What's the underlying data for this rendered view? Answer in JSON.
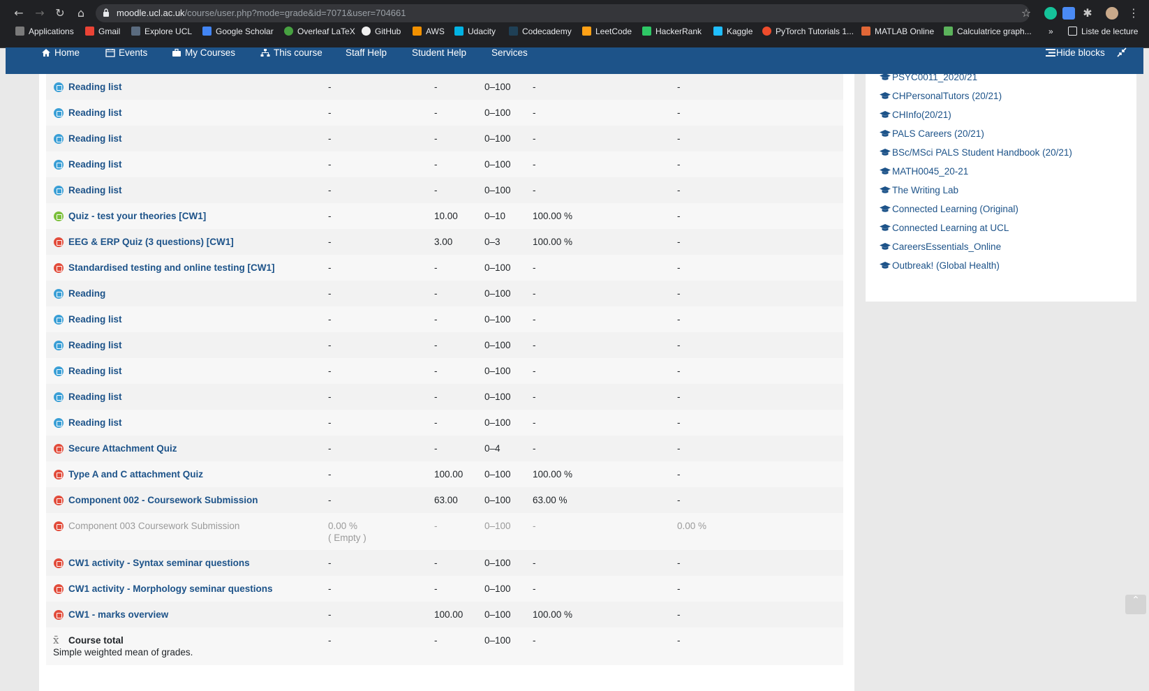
{
  "browser": {
    "url_host": "moodle.ucl.ac.uk",
    "url_path": "/course/user.php?mode=grade&id=7071&user=704661",
    "bookmarks": [
      "Applications",
      "Gmail",
      "Explore UCL",
      "Google Scholar",
      "Overleaf LaTeX",
      "GitHub",
      "AWS",
      "Udacity",
      "Codecademy",
      "LeetCode",
      "HackerRank",
      "Kaggle",
      "PyTorch Tutorials 1...",
      "MATLAB Online",
      "Calculatrice graph...",
      "»",
      "Liste de lecture"
    ]
  },
  "navbar": {
    "home": "Home",
    "events": "Events",
    "my_courses": "My Courses",
    "this_course": "This course",
    "staff_help": "Staff Help",
    "student_help": "Student Help",
    "services": "Services",
    "hide_blocks": "Hide blocks"
  },
  "grades": [
    {
      "name": "Reading list",
      "icon": "blue",
      "weight": "-",
      "grade": "-",
      "range": "0–100",
      "percentage": "-",
      "contribution": "-"
    },
    {
      "name": "Reading list",
      "icon": "blue",
      "weight": "-",
      "grade": "-",
      "range": "0–100",
      "percentage": "-",
      "contribution": "-"
    },
    {
      "name": "Reading list",
      "icon": "blue",
      "weight": "-",
      "grade": "-",
      "range": "0–100",
      "percentage": "-",
      "contribution": "-"
    },
    {
      "name": "Reading list",
      "icon": "blue",
      "weight": "-",
      "grade": "-",
      "range": "0–100",
      "percentage": "-",
      "contribution": "-"
    },
    {
      "name": "Reading list",
      "icon": "blue",
      "weight": "-",
      "grade": "-",
      "range": "0–100",
      "percentage": "-",
      "contribution": "-"
    },
    {
      "name": "Quiz - test your theories [CW1]",
      "icon": "green",
      "weight": "-",
      "grade": "10.00",
      "range": "0–10",
      "percentage": "100.00 %",
      "contribution": "-"
    },
    {
      "name": "EEG & ERP Quiz (3 questions) [CW1]",
      "icon": "red",
      "weight": "-",
      "grade": "3.00",
      "range": "0–3",
      "percentage": "100.00 %",
      "contribution": "-"
    },
    {
      "name": "Standardised testing and online testing [CW1]",
      "icon": "red",
      "weight": "-",
      "grade": "-",
      "range": "0–100",
      "percentage": "-",
      "contribution": "-"
    },
    {
      "name": "Reading",
      "icon": "blue",
      "weight": "-",
      "grade": "-",
      "range": "0–100",
      "percentage": "-",
      "contribution": "-"
    },
    {
      "name": "Reading list",
      "icon": "blue",
      "weight": "-",
      "grade": "-",
      "range": "0–100",
      "percentage": "-",
      "contribution": "-"
    },
    {
      "name": "Reading list",
      "icon": "blue",
      "weight": "-",
      "grade": "-",
      "range": "0–100",
      "percentage": "-",
      "contribution": "-"
    },
    {
      "name": "Reading list",
      "icon": "blue",
      "weight": "-",
      "grade": "-",
      "range": "0–100",
      "percentage": "-",
      "contribution": "-"
    },
    {
      "name": "Reading list",
      "icon": "blue",
      "weight": "-",
      "grade": "-",
      "range": "0–100",
      "percentage": "-",
      "contribution": "-"
    },
    {
      "name": "Reading list",
      "icon": "blue",
      "weight": "-",
      "grade": "-",
      "range": "0–100",
      "percentage": "-",
      "contribution": "-"
    },
    {
      "name": "Secure Attachment Quiz",
      "icon": "red",
      "weight": "-",
      "grade": "-",
      "range": "0–4",
      "percentage": "-",
      "contribution": "-"
    },
    {
      "name": "Type A and C attachment Quiz",
      "icon": "red",
      "weight": "-",
      "grade": "100.00",
      "range": "0–100",
      "percentage": "100.00 %",
      "contribution": "-"
    },
    {
      "name": "Component 002 - Coursework Submission",
      "icon": "red",
      "weight": "-",
      "grade": "63.00",
      "range": "0–100",
      "percentage": "63.00 %",
      "contribution": "-"
    },
    {
      "name": "Component 003 Coursework Submission",
      "icon": "red",
      "weight": "0.00 %",
      "weight_note": "( Empty )",
      "grade": "-",
      "range": "0–100",
      "percentage": "-",
      "contribution": "0.00 %",
      "dim": true
    },
    {
      "name": "CW1 activity - Syntax seminar questions",
      "icon": "red",
      "weight": "-",
      "grade": "-",
      "range": "0–100",
      "percentage": "-",
      "contribution": "-"
    },
    {
      "name": "CW1 activity - Morphology seminar questions",
      "icon": "red",
      "weight": "-",
      "grade": "-",
      "range": "0–100",
      "percentage": "-",
      "contribution": "-"
    },
    {
      "name": "CW1 - marks overview",
      "icon": "red",
      "weight": "-",
      "grade": "100.00",
      "range": "0–100",
      "percentage": "100.00 %",
      "contribution": "-"
    }
  ],
  "course_total": {
    "label": "Course total",
    "note": "Simple weighted mean of grades.",
    "weight": "-",
    "grade": "-",
    "range": "0–100",
    "percentage": "-",
    "contribution": "-"
  },
  "sidebar_courses": [
    "PSYC0011_2020/21",
    "CHPersonalTutors (20/21)",
    "CHInfo(20/21)",
    "PALS Careers (20/21)",
    "BSc/MSci PALS Student Handbook (20/21)",
    "MATH0045_20-21",
    "The Writing Lab",
    "Connected Learning (Original)",
    "Connected Learning at UCL",
    "CareersEssentials_Online",
    "Outbreak! (Global Health)"
  ],
  "colors": {
    "navbar": "#1d5389",
    "link": "#1d5389",
    "chrome": "#202124"
  }
}
